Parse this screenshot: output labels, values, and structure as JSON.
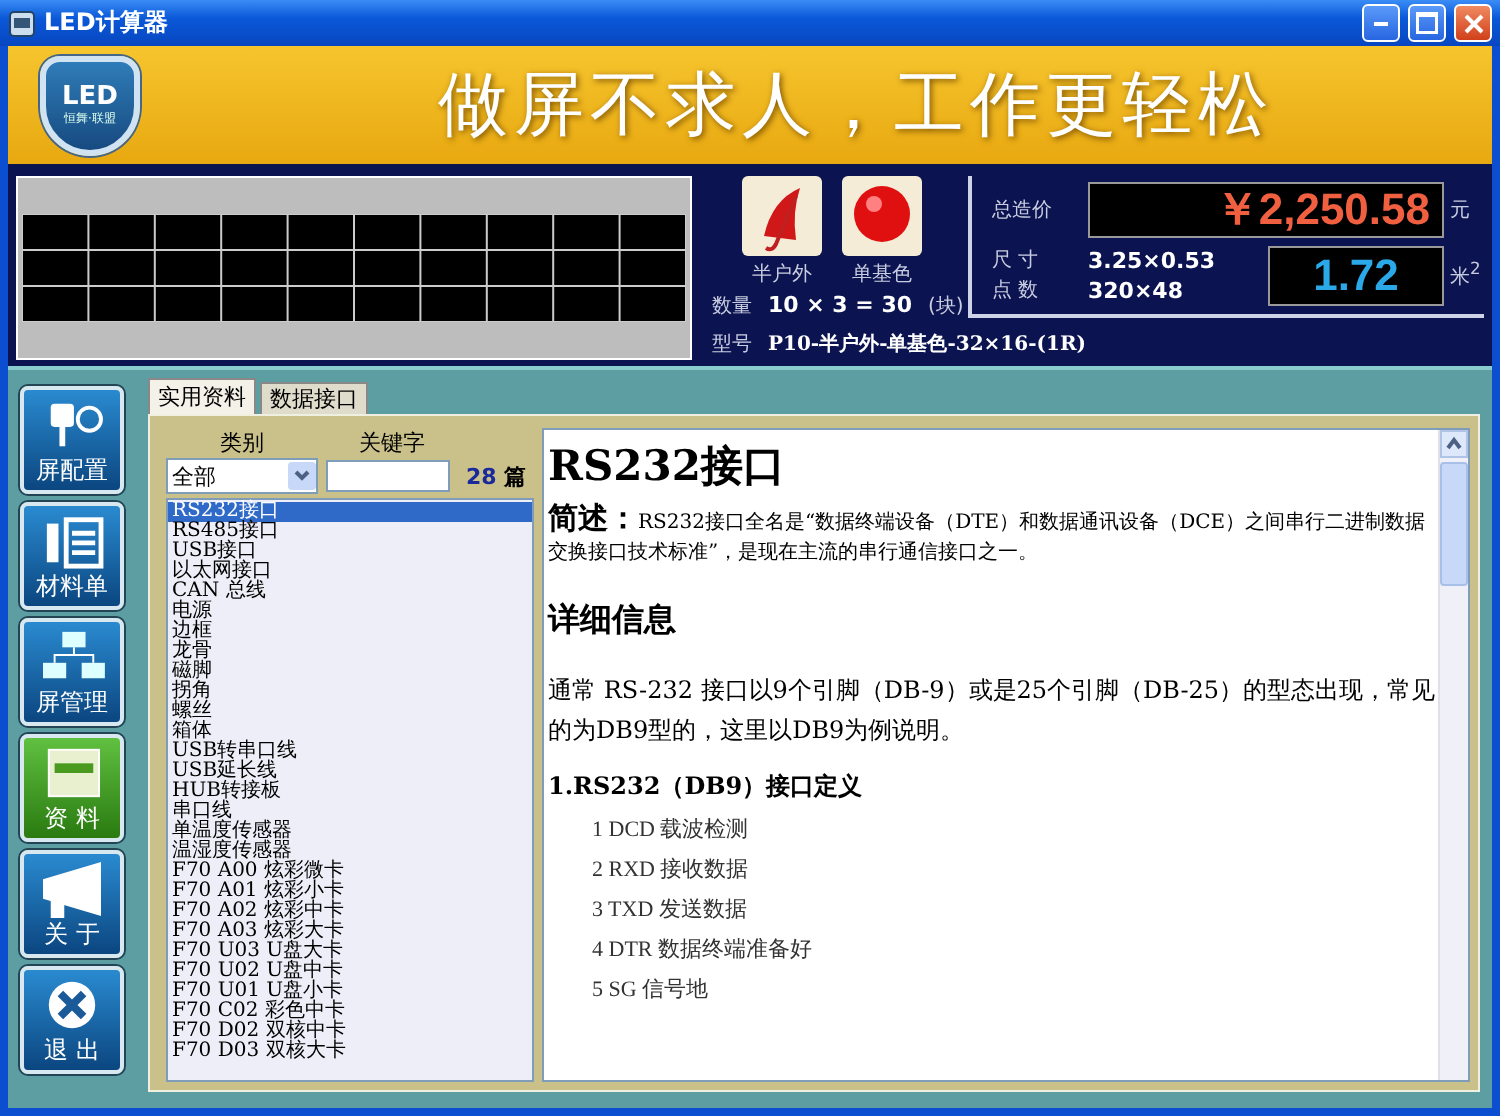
{
  "window": {
    "title": "LED计算器"
  },
  "banner": {
    "logo_text": "LED",
    "logo_subtext": "恒舞·联盟",
    "slogan": "做屏不求人，工作更轻松"
  },
  "display_options": [
    {
      "label": "半户外",
      "kind": "umbrella"
    },
    {
      "label": "单基色",
      "kind": "dot"
    }
  ],
  "quantity": {
    "label": "数量",
    "value": "10 × 3 = 30",
    "unit": "(块)"
  },
  "model": {
    "label": "型号",
    "value": "P10-半户外-单基色-32×16-(1R)"
  },
  "price": {
    "label": "总造价",
    "value": "￥2,250.58",
    "unit": "元"
  },
  "size": {
    "label": "尺 寸",
    "value": "3.25×0.53"
  },
  "pixels": {
    "label": "点 数",
    "value": "320×48"
  },
  "area": {
    "value": "1.72",
    "unit": "米$^{2}$"
  },
  "nav": [
    {
      "label": "屏配置",
      "kind": "plug",
      "selected": false
    },
    {
      "label": "材料单",
      "kind": "list",
      "selected": false
    },
    {
      "label": "屏管理",
      "kind": "network",
      "selected": false
    },
    {
      "label": "资 料",
      "kind": "document",
      "selected": true
    },
    {
      "label": "关 于",
      "kind": "megaphone",
      "selected": false
    },
    {
      "label": "退 出",
      "kind": "exit",
      "selected": false
    }
  ],
  "tabs": [
    {
      "label": "实用资料",
      "selected": true
    },
    {
      "label": "数据接口",
      "selected": false
    }
  ],
  "filter": {
    "category_label": "类别",
    "category_value": "全部",
    "keyword_label": "关键字",
    "count": "28",
    "count_unit": "篇"
  },
  "articles": [
    {
      "title": "RS232接口",
      "selected": true
    },
    {
      "title": "RS485接口",
      "selected": false
    },
    {
      "title": "USB接口",
      "selected": false
    },
    {
      "title": "以太网接口",
      "selected": false
    },
    {
      "title": "CAN 总线",
      "selected": false
    },
    {
      "title": "电源",
      "selected": false
    },
    {
      "title": "边框",
      "selected": false
    },
    {
      "title": "龙骨",
      "selected": false
    },
    {
      "title": "磁脚",
      "selected": false
    },
    {
      "title": "拐角",
      "selected": false
    },
    {
      "title": "螺丝",
      "selected": false
    },
    {
      "title": "箱体",
      "selected": false
    },
    {
      "title": "USB转串口线",
      "selected": false
    },
    {
      "title": "USB延长线",
      "selected": false
    },
    {
      "title": "HUB转接板",
      "selected": false
    },
    {
      "title": "串口线",
      "selected": false
    },
    {
      "title": "单温度传感器",
      "selected": false
    },
    {
      "title": "温湿度传感器",
      "selected": false
    },
    {
      "title": "F70 A00 炫彩微卡",
      "selected": false
    },
    {
      "title": "F70 A01 炫彩小卡",
      "selected": false
    },
    {
      "title": "F70 A02 炫彩中卡",
      "selected": false
    },
    {
      "title": "F70 A03 炫彩大卡",
      "selected": false
    },
    {
      "title": "F70 U03 U盘大卡",
      "selected": false
    },
    {
      "title": "F70 U02 U盘中卡",
      "selected": false
    },
    {
      "title": "F70 U01 U盘小卡",
      "selected": false
    },
    {
      "title": "F70 C02 彩色中卡",
      "selected": false
    },
    {
      "title": "F70 D02 双核中卡",
      "selected": false
    },
    {
      "title": "F70 D03 双核大卡",
      "selected": false
    }
  ],
  "article": {
    "title": "RS232接口",
    "summary_label": "简述：",
    "summary": "RS232接口全名是“数据终端设备（DTE）和数据通讯设备（DCE）之间串行二进制数据交换接口技术标准”，是现在主流的串行通信接口之一。",
    "section_title": "详细信息",
    "paragraph": "通常 RS-232 接口以9个引脚（DB-9）或是25个引脚（DB-25）的型态出现，常见的为DB9型的，这里以DB9为例说明。",
    "subsection_title": "1.RS232（DB9）接口定义",
    "pins": [
      "1 DCD 载波检测",
      "2 RXD 接收数据",
      "3 TXD 发送数据",
      "4 DTR 数据终端准备好",
      "5 SG 信号地"
    ]
  }
}
